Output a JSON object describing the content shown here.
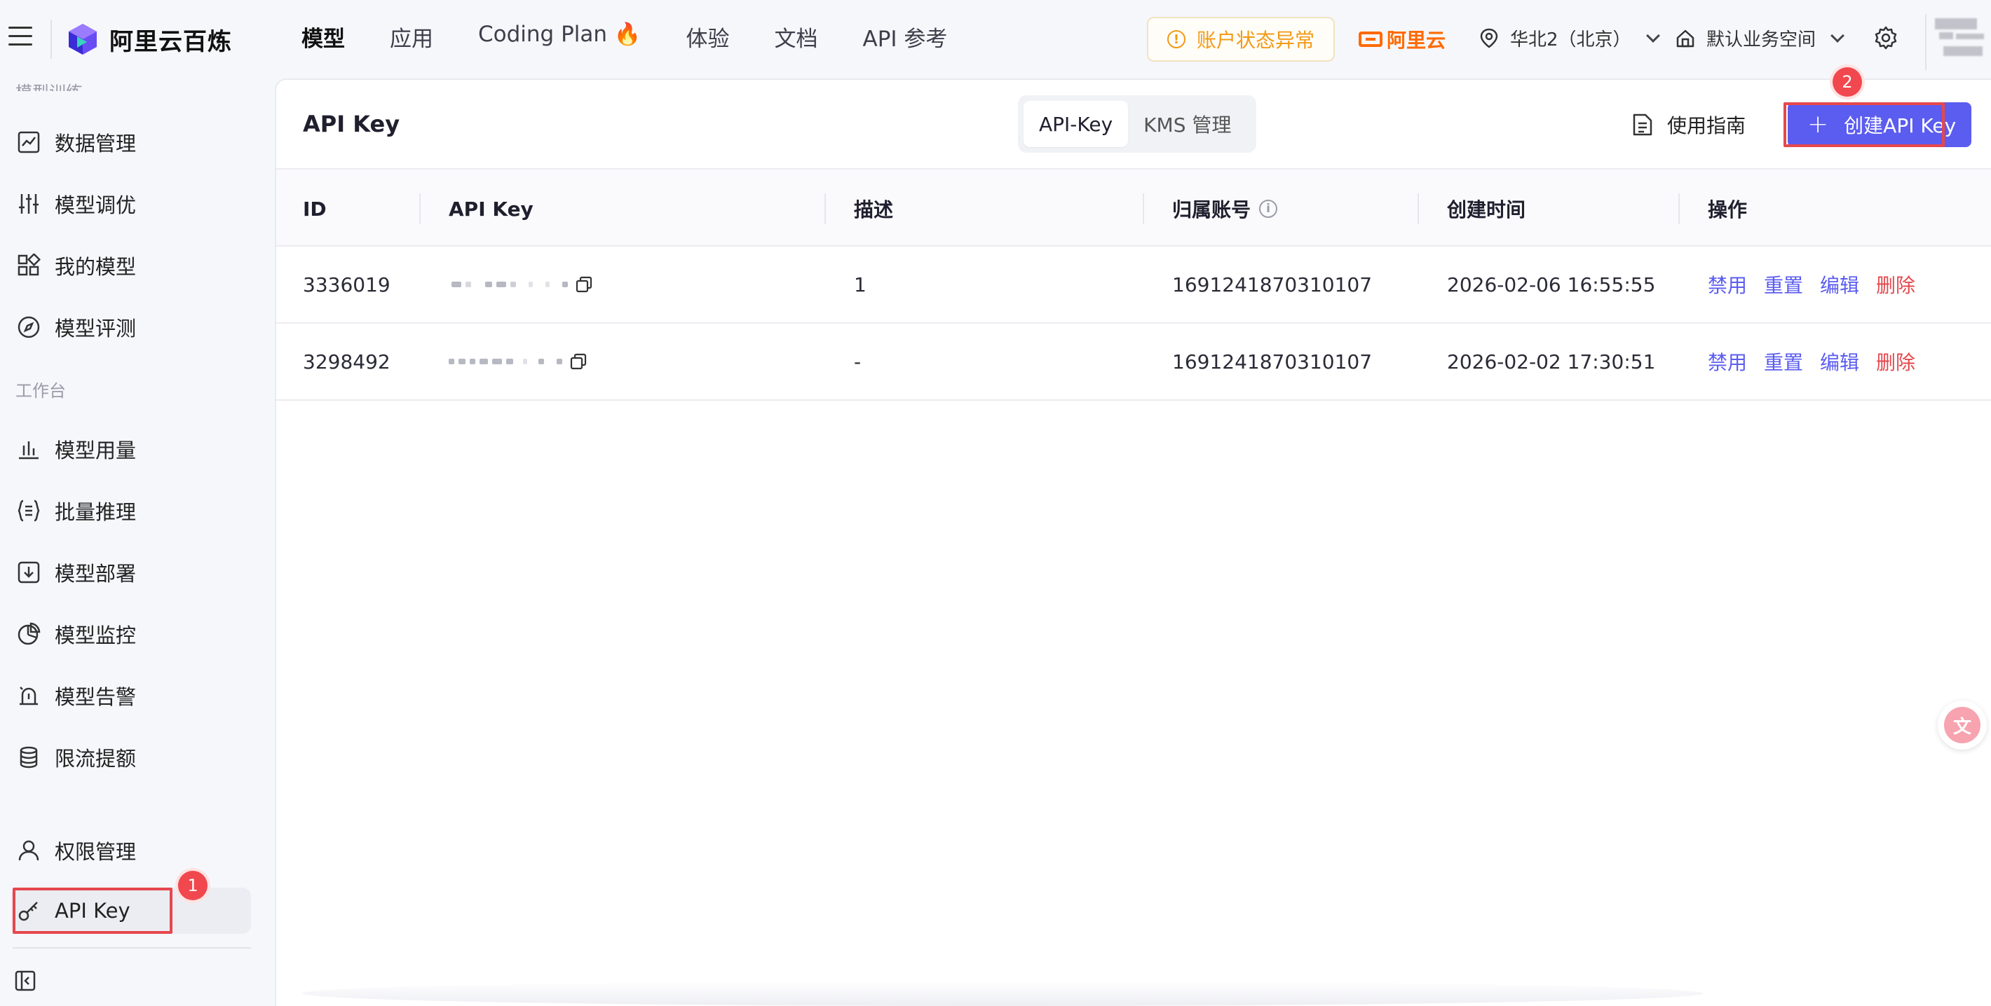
{
  "header": {
    "brand": "阿里云百炼",
    "nav": [
      "模型",
      "应用",
      "Coding Plan 🔥",
      "体验",
      "文档",
      "API 参考"
    ],
    "alert": "账户状态异常",
    "aliyun": "阿里云",
    "region": "华北2（北京）",
    "workspace": "默认业务空间"
  },
  "sidebar": {
    "section_model_training": "模型训练",
    "items_top": [
      "数据管理",
      "模型调优",
      "我的模型",
      "模型评测"
    ],
    "section_workbench": "工作台",
    "items_workbench": [
      "模型用量",
      "批量推理",
      "模型部署",
      "模型监控",
      "模型告警",
      "限流提额"
    ],
    "items_bottom": [
      "权限管理",
      "API Key"
    ],
    "active_item": "API Key"
  },
  "main": {
    "title": "API Key",
    "tabs": [
      "API-Key",
      "KMS 管理"
    ],
    "active_tab": "API-Key",
    "guide_label": "使用指南",
    "create_label": "创建API Key"
  },
  "table": {
    "columns": [
      "ID",
      "API Key",
      "描述",
      "归属账号",
      "创建时间",
      "操作"
    ],
    "rows": [
      {
        "id": "3336019",
        "desc": "1",
        "account": "1691241870310107",
        "created": "2026-02-06 16:55:55"
      },
      {
        "id": "3298492",
        "desc": "-",
        "account": "1691241870310107",
        "created": "2026-02-02 17:30:51"
      }
    ],
    "actions": [
      "禁用",
      "重置",
      "编辑",
      "删除"
    ]
  },
  "annotations": {
    "step1": "1",
    "step2": "2",
    "highlight_color": "#e5484d"
  },
  "colors": {
    "accent": "#5b5cf0",
    "danger": "#e5484d",
    "warning": "#f29a17",
    "aliyun_orange": "#ff6a00"
  }
}
